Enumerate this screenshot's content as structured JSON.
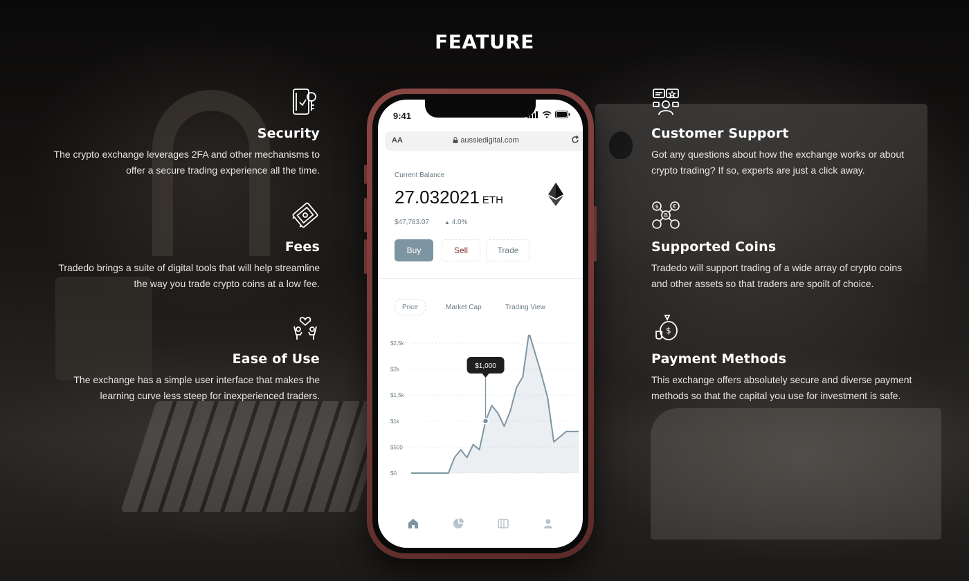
{
  "page": {
    "title": "FEATURE"
  },
  "features_left": [
    {
      "icon": "security-icon",
      "title": "Security",
      "desc_lines": [
        "The crypto exchange leverages 2FA and other mechanisms to",
        "offer a secure trading experience all the time."
      ]
    },
    {
      "icon": "fees-icon",
      "title": "Fees",
      "desc_lines": [
        "Tradedo brings a suite of digital tools that will help streamline",
        "the way you trade crypto coins at a low fee."
      ]
    },
    {
      "icon": "ease-of-use-icon",
      "title": "Ease of Use",
      "desc_lines": [
        "The exchange has a simple user interface that makes the",
        "learning curve less steep for inexperienced traders."
      ]
    }
  ],
  "features_right": [
    {
      "icon": "customer-support-icon",
      "title": "Customer Support",
      "desc_lines": [
        "Got any questions about how the exchange works or about",
        "crypto trading? If so, experts are just a click away."
      ]
    },
    {
      "icon": "supported-coins-icon",
      "title": "Supported Coins",
      "desc_lines": [
        "Tradedo will support trading of a wide array of crypto coins",
        "and other assets so that traders are spoilt of choice."
      ]
    },
    {
      "icon": "payment-methods-icon",
      "title": "Payment Methods",
      "desc_lines": [
        "This exchange offers absolutely secure and diverse payment",
        "methods so that the capital you use for investment is safe."
      ]
    }
  ],
  "phone": {
    "status_time": "9:41",
    "browser": {
      "text_size": "AA",
      "url": "aussiedigital.com"
    },
    "balance": {
      "label": "Current Balance",
      "value": "27.032021",
      "unit": "ETH",
      "usd": "$47,783.07",
      "change": "4.0%"
    },
    "actions": {
      "buy": "Buy",
      "sell": "Sell",
      "trade": "Trade"
    },
    "tabs": {
      "price": "Price",
      "market_cap": "Market Cap",
      "trading_view": "Trading View"
    },
    "tooltip": "$1,000",
    "bottom_nav": [
      "home-icon",
      "pie-chart-icon",
      "wallet-icon",
      "profile-icon"
    ]
  },
  "colors": {
    "accent": "#7d95a3",
    "sell": "#8b2e2e",
    "phone_frame": "#7a3b38"
  },
  "chart_data": {
    "type": "area",
    "title": "",
    "xlabel": "",
    "ylabel": "",
    "y_ticks": [
      "$0",
      "$500",
      "$1k",
      "$1,5k",
      "$2k",
      "$2,5k"
    ],
    "y_tick_values": [
      0,
      500,
      1000,
      1500,
      2000,
      2500
    ],
    "ylim": [
      0,
      2500
    ],
    "grid": true,
    "legend": "none",
    "values": [
      0,
      0,
      0,
      0,
      0,
      0,
      0,
      300,
      450,
      300,
      550,
      450,
      1000,
      1300,
      1150,
      900,
      1200,
      1650,
      1850,
      2700,
      2300,
      1900,
      1450,
      600,
      700,
      800,
      800,
      800
    ],
    "highlight_index": 12
  }
}
